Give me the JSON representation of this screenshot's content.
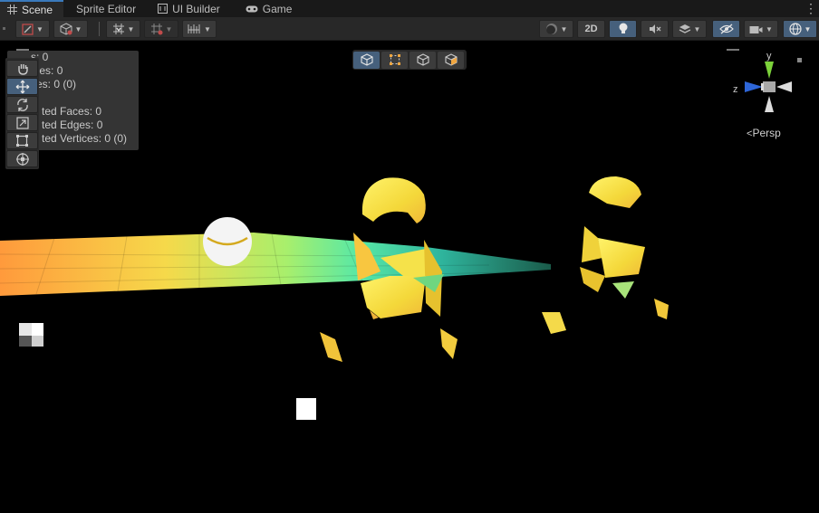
{
  "tabs": [
    {
      "label": "Scene",
      "icon": "grid-icon",
      "active": true
    },
    {
      "label": "Sprite Editor",
      "icon": "",
      "active": false
    },
    {
      "label": "UI Builder",
      "icon": "ui-builder-icon",
      "active": false
    },
    {
      "label": "Game",
      "icon": "gamepad-icon",
      "active": false
    }
  ],
  "toolbar": {
    "two_d_label": "2D"
  },
  "stats": {
    "line1_label": "s: ",
    "line1_value": "0",
    "line2_label": "gles: ",
    "line2_value": "0",
    "line3_label": "ces: ",
    "line3_value": "0 (0)",
    "line4_label": "ted Faces: ",
    "line4_value": "0",
    "line5_label": "ted Edges: ",
    "line5_value": "0",
    "line6_label": "ted Vertices: ",
    "line6_value": "0 (0)"
  },
  "tools": [
    "hand-tool",
    "move-tool",
    "rotate-tool",
    "scale-tool",
    "rect-tool",
    "transform-tool"
  ],
  "gizmo": {
    "y_label": "y",
    "z_label": "z",
    "projection_label": "Persp"
  },
  "colors": {
    "accent": "#3a79bb",
    "selected": "#46607c",
    "toolbar_bg": "#282828",
    "tab_bg": "#191919"
  }
}
